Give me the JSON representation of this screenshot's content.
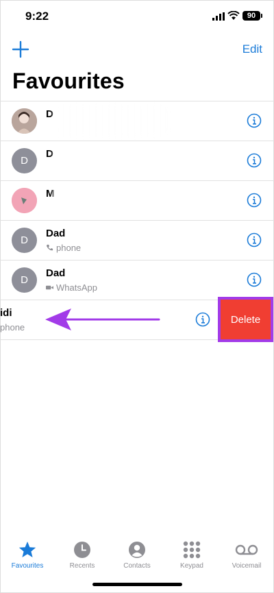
{
  "status": {
    "time": "9:22",
    "battery": "90"
  },
  "nav": {
    "edit_label": "Edit"
  },
  "page": {
    "title": "Favourites"
  },
  "contacts": [
    {
      "name": "D",
      "sub": "",
      "avatar": "",
      "blurred": true,
      "type": "photo"
    },
    {
      "name": "D",
      "sub": "",
      "avatar": "D",
      "blurred": true,
      "type": "initial"
    },
    {
      "name": "M",
      "sub": "",
      "avatar": "",
      "blurred": true,
      "type": "pink"
    },
    {
      "name": "Dad",
      "sub": "phone",
      "avatar": "D",
      "blurred": false,
      "type": "initial"
    },
    {
      "name": "Dad",
      "sub": "WhatsApp",
      "avatar": "D",
      "blurred": false,
      "type": "initial",
      "video": true
    },
    {
      "name": "idi",
      "sub": "phone",
      "swiped": true
    }
  ],
  "swipe_action": {
    "delete_label": "Delete"
  },
  "tabs": [
    {
      "label": "Favourites",
      "icon": "star-icon",
      "active": true
    },
    {
      "label": "Recents",
      "icon": "clock-icon",
      "active": false
    },
    {
      "label": "Contacts",
      "icon": "person-icon",
      "active": false
    },
    {
      "label": "Keypad",
      "icon": "keypad-icon",
      "active": false
    },
    {
      "label": "Voicemail",
      "icon": "voicemail-icon",
      "active": false
    }
  ],
  "colors": {
    "accent": "#1a7bd8",
    "delete": "#f03e32",
    "highlight": "#a23be8"
  }
}
